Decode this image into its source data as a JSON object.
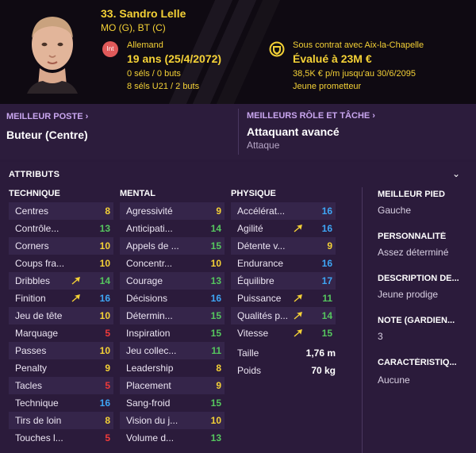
{
  "player": {
    "name": "33. Sandro Lelle",
    "positions": "MO (G), BT (C)",
    "nationality_badge": "Int",
    "nationality": "Allemand",
    "age": "19 ans (25/4/2072)",
    "caps_senior": "0 séls / 0 buts",
    "caps_u21": "8 séls U21 / 2 buts",
    "contract": "Sous contrat avec Aix-la-Chapelle",
    "value": "Évalué à 23M €",
    "wage": "38,5K € p/m jusqu'au 30/6/2095",
    "status": "Jeune prometteur"
  },
  "roles": {
    "best_position_label": "MEILLEUR POSTE",
    "best_position": "Buteur (Centre)",
    "best_role_label": "MEILLEURS RÔLE ET TÂCHE",
    "best_role": "Attaquant avancé",
    "best_duty": "Attaque"
  },
  "attributes": {
    "title": "ATTRIBUTS",
    "technical_header": "TECHNIQUE",
    "mental_header": "MENTAL",
    "physical_header": "PHYSIQUE",
    "technical": [
      {
        "label": "Centres",
        "value": "8"
      },
      {
        "label": "Contrôle...",
        "value": "13"
      },
      {
        "label": "Corners",
        "value": "10"
      },
      {
        "label": "Coups fra...",
        "value": "10"
      },
      {
        "label": "Dribbles",
        "value": "14",
        "arrow": true
      },
      {
        "label": "Finition",
        "value": "16",
        "arrow": true
      },
      {
        "label": "Jeu de tête",
        "value": "10"
      },
      {
        "label": "Marquage",
        "value": "5"
      },
      {
        "label": "Passes",
        "value": "10"
      },
      {
        "label": "Penalty",
        "value": "9"
      },
      {
        "label": "Tacles",
        "value": "5"
      },
      {
        "label": "Technique",
        "value": "16"
      },
      {
        "label": "Tirs de loin",
        "value": "8"
      },
      {
        "label": "Touches l...",
        "value": "5"
      }
    ],
    "mental": [
      {
        "label": "Agressivité",
        "value": "9"
      },
      {
        "label": "Anticipati...",
        "value": "14"
      },
      {
        "label": "Appels de ...",
        "value": "15"
      },
      {
        "label": "Concentr...",
        "value": "10"
      },
      {
        "label": "Courage",
        "value": "13"
      },
      {
        "label": "Décisions",
        "value": "16"
      },
      {
        "label": "Détermin...",
        "value": "15"
      },
      {
        "label": "Inspiration",
        "value": "15"
      },
      {
        "label": "Jeu collec...",
        "value": "11"
      },
      {
        "label": "Leadership",
        "value": "8"
      },
      {
        "label": "Placement",
        "value": "9"
      },
      {
        "label": "Sang-froid",
        "value": "15"
      },
      {
        "label": "Vision du j...",
        "value": "10"
      },
      {
        "label": "Volume d...",
        "value": "13"
      }
    ],
    "physical": [
      {
        "label": "Accélérat...",
        "value": "16"
      },
      {
        "label": "Agilité",
        "value": "16",
        "arrow": true
      },
      {
        "label": "Détente v...",
        "value": "9"
      },
      {
        "label": "Endurance",
        "value": "16"
      },
      {
        "label": "Équilibre",
        "value": "17"
      },
      {
        "label": "Puissance",
        "value": "11",
        "arrow": true
      },
      {
        "label": "Qualités p...",
        "value": "14",
        "arrow": true
      },
      {
        "label": "Vitesse",
        "value": "15",
        "arrow": true
      }
    ],
    "height_label": "Taille",
    "height": "1,76 m",
    "weight_label": "Poids",
    "weight": "70 kg"
  },
  "side": {
    "best_foot_label": "MEILLEUR PIED",
    "best_foot": "Gauche",
    "personality_label": "PERSONNALITÉ",
    "personality": "Assez déterminé",
    "media_label": "DESCRIPTION DE...",
    "media": "Jeune prodige",
    "gk_label": "NOTE (GARDIEN...",
    "gk": "3",
    "traits_label": "CARACTÉRISTIQ...",
    "traits": "Aucune"
  },
  "colors": {
    "red": "#f03a3a",
    "yellow": "#f4d136",
    "green": "#55c65e",
    "blue": "#3ea6f5",
    "header_bg": "#0f0a12",
    "panel_bg": "#2b1b3b"
  }
}
